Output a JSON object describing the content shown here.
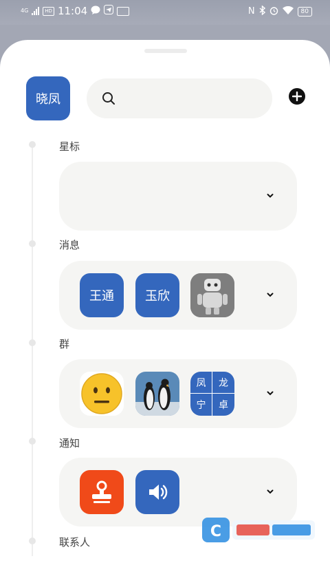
{
  "status_bar": {
    "network": "4G",
    "hd_badge": "HD",
    "time": "11:04",
    "battery": "80"
  },
  "profile": {
    "name": "晓凤"
  },
  "search": {
    "placeholder": ""
  },
  "sections": {
    "starred": {
      "label": "星标"
    },
    "messages": {
      "label": "消息",
      "contacts": [
        "王通",
        "玉欣"
      ]
    },
    "groups": {
      "label": "群",
      "grid_chars": [
        "凤",
        "龙",
        "宁",
        "卓"
      ]
    },
    "notifications": {
      "label": "通知"
    },
    "contacts": {
      "label": "联系人"
    }
  },
  "colors": {
    "accent": "#3467bd",
    "orange": "#f04a19",
    "card": "#f5f5f3"
  }
}
